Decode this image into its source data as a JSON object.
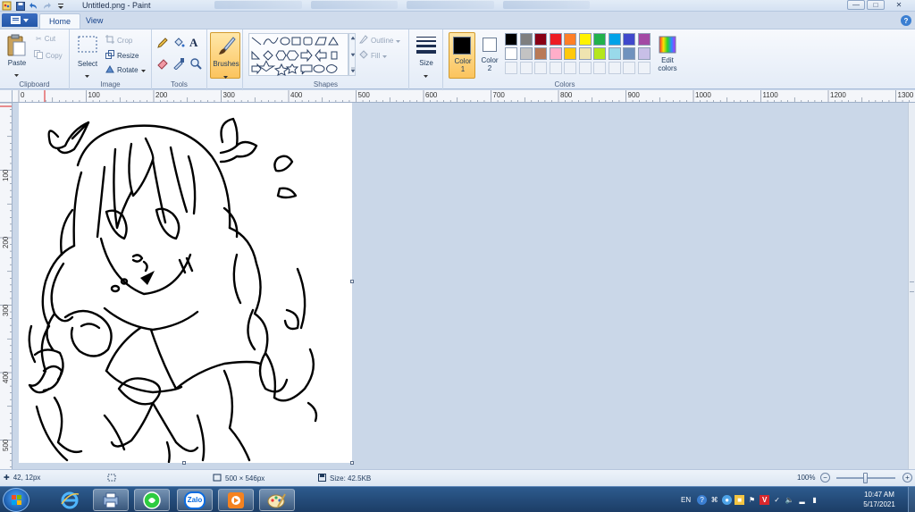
{
  "window": {
    "title": "Untitled.png - Paint",
    "controls": [
      "minimize-icon",
      "maximize-icon",
      "close-icon"
    ]
  },
  "ribbon_tabs": [
    {
      "label": "Home",
      "active": true
    },
    {
      "label": "View",
      "active": false
    }
  ],
  "clipboard": {
    "paste": "Paste",
    "cut": "Cut",
    "copy": "Copy",
    "group_label": "Clipboard"
  },
  "image": {
    "select": "Select",
    "crop": "Crop",
    "resize": "Resize",
    "rotate": "Rotate",
    "group_label": "Image"
  },
  "tools": {
    "group_label": "Tools",
    "icons": [
      "pencil-icon",
      "fill-icon",
      "text-icon",
      "eraser-icon",
      "color-picker-icon",
      "magnifier-icon"
    ]
  },
  "brushes": {
    "label": "Brushes"
  },
  "shapes": {
    "outline": "Outline",
    "fill": "Fill",
    "group_label": "Shapes"
  },
  "size": {
    "label": "Size"
  },
  "colors": {
    "color1_label": "Color",
    "color1_num": "1",
    "color2_label": "Color",
    "color2_num": "2",
    "edit_label": "Edit",
    "edit_label2": "colors",
    "group_label": "Colors",
    "color1": "#000000",
    "color2": "#ffffff",
    "palette_row1": [
      "#000000",
      "#7f7f7f",
      "#880015",
      "#ed1c24",
      "#ff7f27",
      "#fff200",
      "#22b14c",
      "#00a2e8",
      "#3f48cc",
      "#a349a4"
    ],
    "palette_row2": [
      "#ffffff",
      "#c3c3c3",
      "#b97a57",
      "#ffaec9",
      "#ffc90e",
      "#efe4b0",
      "#b5e61d",
      "#99d9ea",
      "#7092be",
      "#c8bfe7"
    ]
  },
  "ruler": {
    "h_labels": [
      "0",
      "100",
      "200",
      "300",
      "400",
      "500",
      "600",
      "700",
      "800",
      "900",
      "1000",
      "1100",
      "1200",
      "1300"
    ],
    "v_labels": [
      "100",
      "200",
      "300",
      "400",
      "500"
    ]
  },
  "status": {
    "cursor_pos": "42, 12px",
    "image_size": "500 × 546px",
    "file_size": "Size: 42.5KB",
    "zoom": "100%"
  },
  "taskbar": {
    "apps": [
      "internet-explorer-icon",
      "printer-app-icon",
      "green-app-icon",
      "zalo-icon",
      "media-player-icon",
      "paint-icon"
    ],
    "zalo_label": "Zalo",
    "lang": "EN",
    "time": "10:47 AM",
    "date": "5/17/2021"
  }
}
